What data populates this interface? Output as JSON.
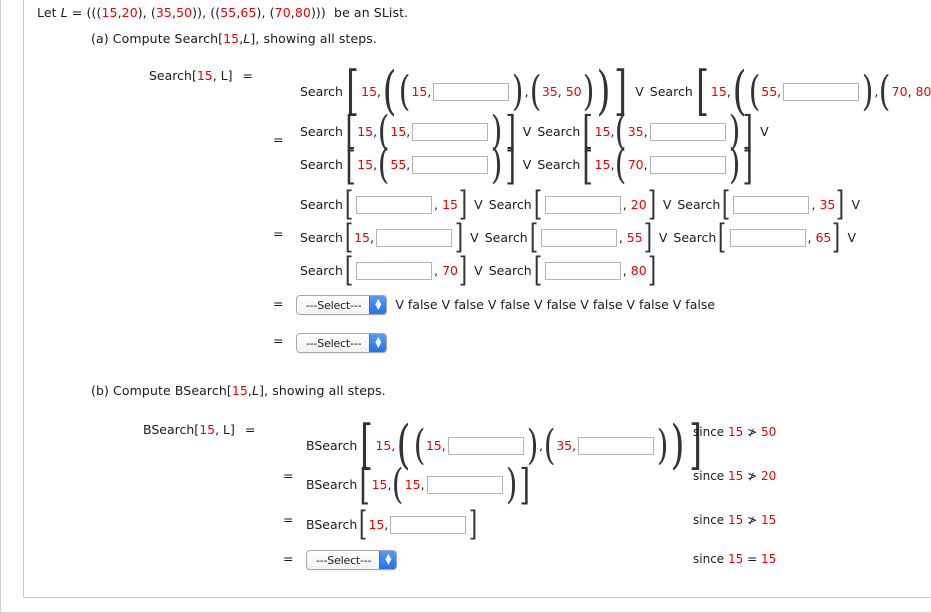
{
  "preamble": {
    "let": "Let",
    "var": "L",
    "eq": "=",
    "list_open": "(((",
    "v1": "15",
    "c1": ", ",
    "v2": "20",
    "mid1": "), (",
    "v3": "35",
    "c2": ", ",
    "v4": "50",
    "mid2": ")), ((",
    "v5": "55",
    "c3": ", ",
    "v6": "65",
    "mid3": "), (",
    "v7": "70",
    "c4": ", ",
    "v8": "80",
    "list_close": ")))",
    "tail": "be an SList."
  },
  "part_a": {
    "label": "(a) Compute Search[",
    "label_num": "15",
    "label_mid": ", ",
    "label_var": "L",
    "label_tail": "], showing all steps.",
    "lhs": "Search[",
    "lhs_num": "15",
    "lhs_mid": ", L]",
    "equals": "=",
    "fn": "Search",
    "vee": "V",
    "step1": {
      "key": "15",
      "a_key": "15",
      "b_key": "35",
      "b_val": "50",
      "c_key": "15",
      "d_key": "55",
      "e_key": "70",
      "e_val": "80"
    },
    "step2": {
      "t1_key": "15",
      "t1_inner": "15",
      "t2_key": "15",
      "t2_inner": "35",
      "t3_key": "15",
      "t3_inner": "55",
      "t4_key": "15",
      "t4_inner": "70"
    },
    "step3": {
      "t1_val": "15",
      "t2_val": "20",
      "t3_val": "35",
      "t4_key": "15",
      "t5_val": "55",
      "t6_val": "65",
      "t7_val": "70",
      "t8_val": "80"
    },
    "step4": {
      "select": "---Select---",
      "tail": "V false V false V false V false V false V false V false"
    },
    "step5": {
      "select": "---Select---"
    }
  },
  "part_b": {
    "label": "(b) Compute BSearch[",
    "label_num": "15",
    "label_mid": ", ",
    "label_var": "L",
    "label_tail": "], showing all steps.",
    "lhs": "BSearch[",
    "lhs_num": "15",
    "lhs_mid": ", L]",
    "equals": "=",
    "fn": "BSearch",
    "rows": [
      {
        "key": "15",
        "a_key": "15",
        "b_key": "35",
        "since": "since",
        "s1": "15",
        "op": "≯",
        "s2": "50"
      },
      {
        "key": "15",
        "a_key": "15",
        "since": "since",
        "s1": "15",
        "op": "≯",
        "s2": "20"
      },
      {
        "key": "15",
        "since": "since",
        "s1": "15",
        "op": "≯",
        "s2": "15"
      },
      {
        "select": "---Select---",
        "since": "since",
        "s1": "15",
        "op": "=",
        "s2": "15"
      }
    ]
  },
  "colors": {
    "accent_red": "#ee0000",
    "select_blue": "#2272ea",
    "box_border": "#b4b4b4",
    "frame": "#c9c9c9"
  },
  "icons": {
    "stepper": "chevron-up-down-icon"
  }
}
